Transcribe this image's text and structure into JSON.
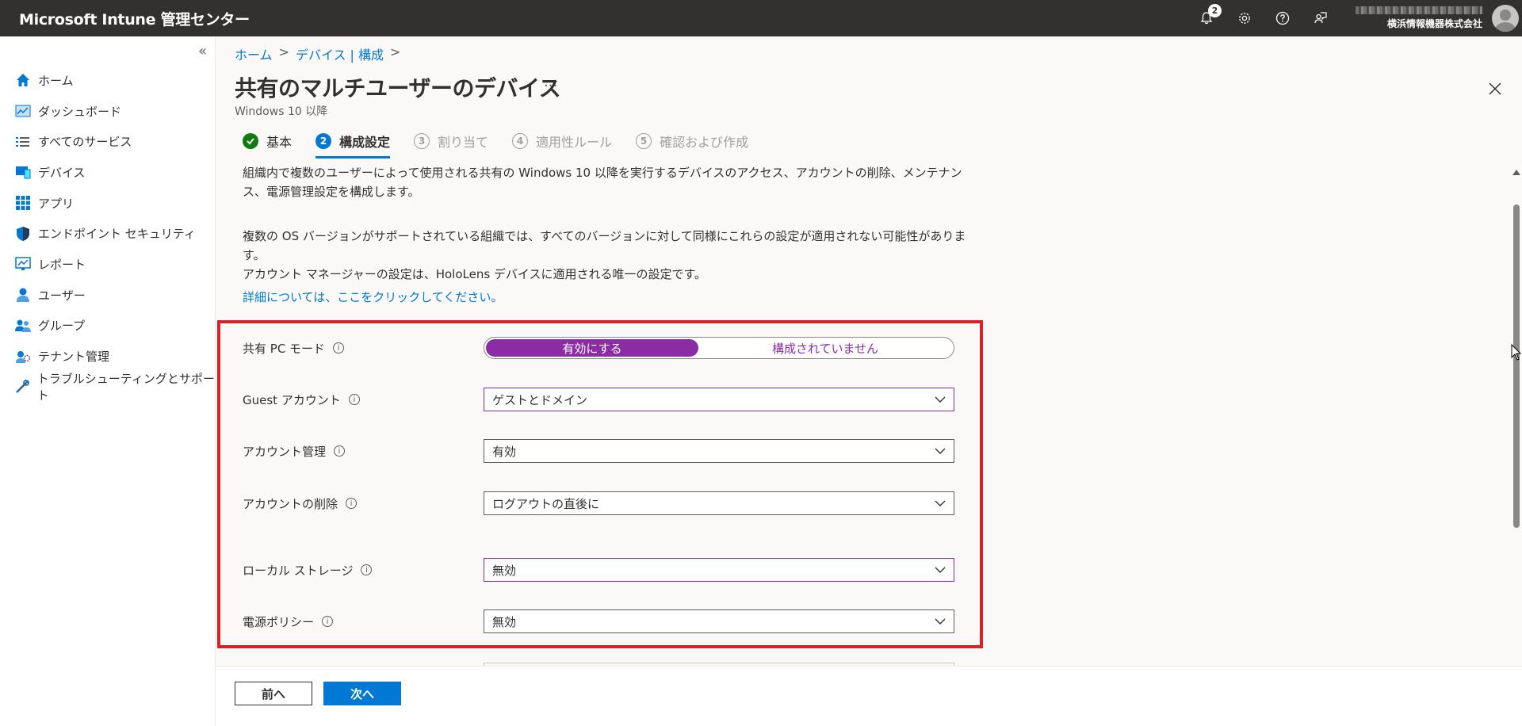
{
  "topbar": {
    "title": "Microsoft Intune 管理センター",
    "notification_count": "2",
    "account_org": "横浜情報機器株式会社"
  },
  "sidebar": {
    "items": [
      {
        "label": "ホーム",
        "icon": "home-icon"
      },
      {
        "label": "ダッシュボード",
        "icon": "dashboard-icon"
      },
      {
        "label": "すべてのサービス",
        "icon": "list-icon"
      },
      {
        "label": "デバイス",
        "icon": "device-icon"
      },
      {
        "label": "アプリ",
        "icon": "apps-grid-icon"
      },
      {
        "label": "エンドポイント セキュリティ",
        "icon": "shield-icon"
      },
      {
        "label": "レポート",
        "icon": "report-icon"
      },
      {
        "label": "ユーザー",
        "icon": "user-icon"
      },
      {
        "label": "グループ",
        "icon": "group-icon"
      },
      {
        "label": "テナント管理",
        "icon": "tenant-icon"
      },
      {
        "label": "トラブルシューティングとサポート",
        "icon": "wrench-icon"
      }
    ]
  },
  "breadcrumb": {
    "home": "ホーム",
    "sep1": ">",
    "devices": "デバイス | 構成",
    "sep2": ">"
  },
  "page": {
    "title": "共有のマルチユーザーのデバイス",
    "more": "···",
    "subtitle": "Windows 10 以降"
  },
  "steps": [
    {
      "num": "",
      "label": "基本",
      "state": "done"
    },
    {
      "num": "2",
      "label": "構成設定",
      "state": "active"
    },
    {
      "num": "3",
      "label": "割り当て",
      "state": "future"
    },
    {
      "num": "4",
      "label": "適用性ルール",
      "state": "future"
    },
    {
      "num": "5",
      "label": "確認および作成",
      "state": "future"
    }
  ],
  "description": {
    "para1_line1": "組織内で複数のユーザーによって使用される共有の Windows 10 以降を実行するデバイスのアクセス、アカウントの削除、メンテナン",
    "para1_line2": "ス、電源管理設定を構成します。",
    "para2_line1": "複数の OS バージョンがサポートされている組織では、すべてのバージョンに対して同様にこれらの設定が適用されない可能性があります。",
    "para2_line2": "アカウント マネージャーの設定は、HoloLens デバイスに適用される唯一の設定です。",
    "link": "詳細については、ここをクリックしてください。"
  },
  "settings": {
    "shared_pc_mode": {
      "label": "共有 PC モード",
      "on_label": "有効にする",
      "off_label": "構成されていません"
    },
    "guest_account": {
      "label": "Guest アカウント",
      "value": "ゲストとドメイン"
    },
    "account_management": {
      "label": "アカウント管理",
      "value": "有効"
    },
    "account_deletion": {
      "label": "アカウントの削除",
      "value": "ログアウトの直後に"
    },
    "local_storage": {
      "label": "ローカル ストレージ",
      "value": "無効"
    },
    "power_policy": {
      "label": "電源ポリシー",
      "value": "無効"
    }
  },
  "footer": {
    "prev": "前へ",
    "next": "次へ"
  },
  "colors": {
    "accent": "#0078d4",
    "toggle_purple": "#8a2da5",
    "highlight_red": "#d92128",
    "topbar": "#323130"
  }
}
